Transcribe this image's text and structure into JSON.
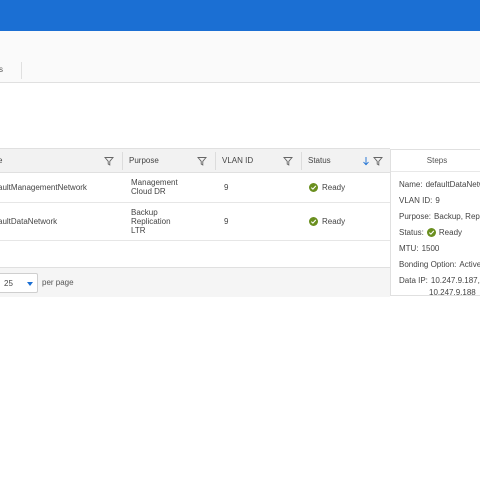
{
  "subnav": {
    "tab_label": "s"
  },
  "grid": {
    "columns": [
      {
        "label": "e"
      },
      {
        "label": "Purpose"
      },
      {
        "label": "VLAN ID"
      },
      {
        "label": "Status"
      }
    ],
    "rows": [
      {
        "name": "aultManagementNetwork",
        "purpose": [
          "Management",
          "Cloud DR"
        ],
        "vlan": "9",
        "status": "Ready"
      },
      {
        "name": "aultDataNetwork",
        "purpose": [
          "Backup",
          "Replication",
          "LTR"
        ],
        "vlan": "9",
        "status": "Ready"
      }
    ],
    "pager": {
      "page_size": "25",
      "per_page_label": "per page"
    }
  },
  "panel": {
    "title": "Steps",
    "name_label": "Name:",
    "name_value": "defaultDataNetw",
    "vlan_label": "VLAN ID:",
    "vlan_value": "9",
    "purpose_label": "Purpose:",
    "purpose_value": "Backup, Replic",
    "status_label": "Status:",
    "status_value": "Ready",
    "mtu_label": "MTU:",
    "mtu_value": "1500",
    "bonding_label": "Bonding Option:",
    "bonding_value": "Active/",
    "dataip_label": "Data IP:",
    "dataip_value_1": "10.247.9.187,",
    "dataip_value_2": "10.247.9.188"
  },
  "colors": {
    "brand": "#1b6fd3",
    "status_ok": "#6a8f1f"
  }
}
